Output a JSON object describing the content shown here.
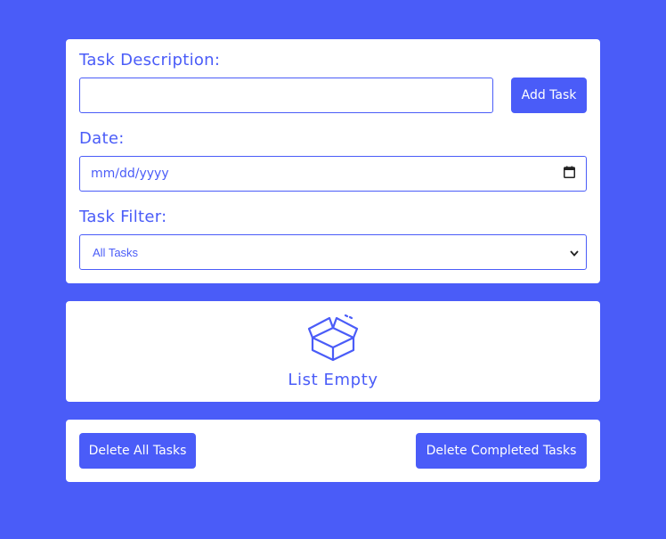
{
  "form": {
    "task_label": "Task Description:",
    "task_value": "",
    "add_button": "Add Task",
    "date_label": "Date:",
    "date_placeholder": "mm/dd/yyyy",
    "filter_label": "Task Filter:",
    "filter_selected": "All Tasks"
  },
  "empty_state": {
    "icon": "open-box-icon",
    "text": "List Empty"
  },
  "actions": {
    "delete_all": "Delete All Tasks",
    "delete_completed": "Delete Completed Tasks"
  },
  "colors": {
    "accent": "#4a5cf8",
    "background": "#4a5cf8",
    "card": "#ffffff"
  }
}
